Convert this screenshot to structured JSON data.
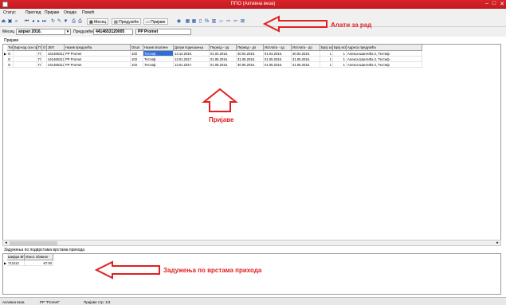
{
  "window": {
    "title": "ППО (Активна веза)",
    "minimize": "–",
    "maximize": "□",
    "close": "✕"
  },
  "menu": [
    "Статус",
    "Преглед",
    "Пријаве",
    "Опције",
    "Помоћ"
  ],
  "toolbar": {
    "icons": [
      "exit-icon",
      "save-icon",
      "search-icon",
      "first-record-icon",
      "previous-record-icon",
      "next-record-icon",
      "last-record-icon",
      "refresh-icon",
      "print-icon",
      "filter-icon",
      "print-preview-icon",
      "print-setup-icon"
    ],
    "buttons": [
      {
        "label": "Месец",
        "icon": "calendar-icon"
      },
      {
        "label": "Предузеће",
        "icon": "company-icon"
      },
      {
        "label": "Пријаве",
        "icon": "document-icon"
      }
    ],
    "icons2": [
      "globe-icon",
      "report-icon",
      "report2-icon",
      "doc-icon",
      "pct-icon",
      "chart-icon",
      "folder-icon",
      "export-icon",
      "import-icon",
      "close-doc-icon"
    ]
  },
  "params": {
    "month_label": "Месец",
    "month_value": "април 2016.",
    "company_label": "Предузеће",
    "company_pib": "4414653120005",
    "company_name": "PP Promet"
  },
  "grid": {
    "title": "Пријаве",
    "columns": [
      "Тип",
      "Бар-код осн.пр.",
      "П",
      "О",
      "ЈБП",
      "Назив предузећа",
      "Општ.",
      "Назив општине",
      "Датум подношења",
      "Период - од",
      "Период - до",
      "Исплата - од",
      "Исплата - до",
      "Број зап.",
      "Број испл.",
      "Адреса предузећа"
    ],
    "rows": [
      [
        "О",
        "",
        "П",
        "",
        "4414653120005",
        "PP Promet",
        "103",
        "Тестиф",
        "13.12.2016.",
        "01.04.2016.",
        "30.04.2016.",
        "01.04.2016.",
        "30.04.2016.",
        "1",
        "1",
        "Алекса Шантића 2, Тестиф"
      ],
      [
        "О",
        "",
        "П",
        "",
        "4414653120005",
        "PP Promet",
        "103",
        "Тестиф",
        "13.01.2017.",
        "01.05.2016.",
        "31.05.2016.",
        "01.05.2016.",
        "31.05.2016.",
        "1",
        "1",
        "Алекса Шантића 2, Тестиф"
      ],
      [
        "О",
        "",
        "П",
        "",
        "4414653120005",
        "PP Promet",
        "103",
        "Тестиф",
        "13.01.2017.",
        "01.06.2016.",
        "30.06.2016.",
        "01.05.2016.",
        "31.05.2016.",
        "1",
        "1",
        "Алекса Шантића 2, Тестиф"
      ]
    ]
  },
  "debts": {
    "title": "Задужења по подврстама врстама прихода",
    "columns": [
      "Шифра ВП",
      "Износ обавезе"
    ],
    "rows": [
      [
        "713113",
        "67.00"
      ]
    ]
  },
  "status": [
    "Активна веза",
    "PP \"Promet\"",
    "Пријаве стр: 1/3"
  ],
  "annotations": {
    "tools": "Алати за рад",
    "applications": "Пријаве",
    "debts": "Задужења по врстама прихода",
    "color": "#e02020"
  }
}
